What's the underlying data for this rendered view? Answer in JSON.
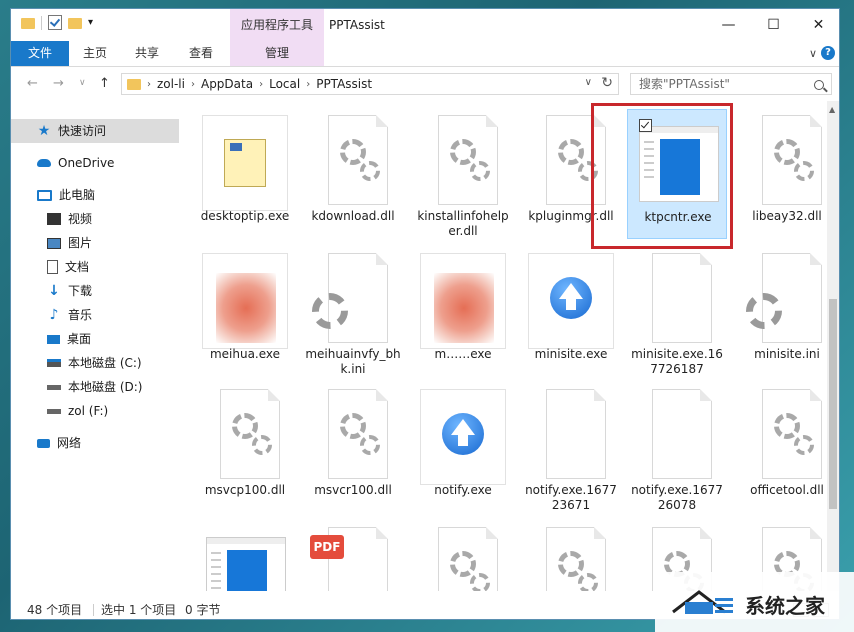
{
  "titlebar": {
    "context_tab": "应用程序工具",
    "title": "PPTAssist",
    "minimize": "—",
    "maximize": "☐",
    "close": "✕"
  },
  "ribbon": {
    "tabs": [
      "文件",
      "主页",
      "共享",
      "查看",
      "管理"
    ],
    "expand": "∨",
    "help": "?"
  },
  "address": {
    "crumbs": [
      "zol-li",
      "AppData",
      "Local",
      "PPTAssist"
    ],
    "search_placeholder": "搜索\"PPTAssist\""
  },
  "sidebar": {
    "items": [
      {
        "label": "快速访问",
        "icon": "star-icon"
      },
      {
        "label": "OneDrive",
        "icon": "cloud-icon"
      },
      {
        "label": "此电脑",
        "icon": "computer-icon"
      },
      {
        "label": "视频",
        "icon": "video-icon"
      },
      {
        "label": "图片",
        "icon": "picture-icon"
      },
      {
        "label": "文档",
        "icon": "document-icon"
      },
      {
        "label": "下载",
        "icon": "download-icon"
      },
      {
        "label": "音乐",
        "icon": "music-icon"
      },
      {
        "label": "桌面",
        "icon": "desktop-icon"
      },
      {
        "label": "本地磁盘 (C:)",
        "icon": "drive-c-icon"
      },
      {
        "label": "本地磁盘 (D:)",
        "icon": "drive-d-icon"
      },
      {
        "label": "zol (F:)",
        "icon": "drive-f-icon"
      },
      {
        "label": "网络",
        "icon": "network-icon"
      }
    ]
  },
  "files": [
    {
      "name": "desktoptip.exe",
      "type": "exe-doc"
    },
    {
      "name": "kdownload.dll",
      "type": "gear"
    },
    {
      "name": "kinstallinfohelper.dll",
      "type": "gear"
    },
    {
      "name": "kpluginmgr.dll",
      "type": "gear"
    },
    {
      "name": "ktpcntr.exe",
      "type": "app",
      "selected": true
    },
    {
      "name": "libeay32.dll",
      "type": "gear"
    },
    {
      "name": "meihua.exe",
      "type": "blurred"
    },
    {
      "name": "meihuainvfy_bhk.ini",
      "type": "gear-ini"
    },
    {
      "name": "m……exe",
      "type": "blurred"
    },
    {
      "name": "minisite.exe",
      "type": "arrow"
    },
    {
      "name": "minisite.exe.167726187",
      "type": "blank"
    },
    {
      "name": "minisite.ini",
      "type": "gear-ini"
    },
    {
      "name": "msvcp100.dll",
      "type": "gear"
    },
    {
      "name": "msvcr100.dll",
      "type": "gear"
    },
    {
      "name": "notify.exe",
      "type": "arrow"
    },
    {
      "name": "notify.exe.167723671",
      "type": "blank"
    },
    {
      "name": "notify.exe.167726078",
      "type": "blank"
    },
    {
      "name": "officetool.dll",
      "type": "gear"
    },
    {
      "name": "",
      "type": "app"
    },
    {
      "name": "",
      "type": "pdf",
      "badge": "PDF"
    },
    {
      "name": "",
      "type": "gear"
    },
    {
      "name": "",
      "type": "gear"
    },
    {
      "name": "",
      "type": "gear"
    },
    {
      "name": "",
      "type": "gear"
    }
  ],
  "status": {
    "count": "48 个项目",
    "selection": "选中 1 个项目",
    "size": "0 字节"
  },
  "watermark": {
    "text": "系统之家"
  }
}
